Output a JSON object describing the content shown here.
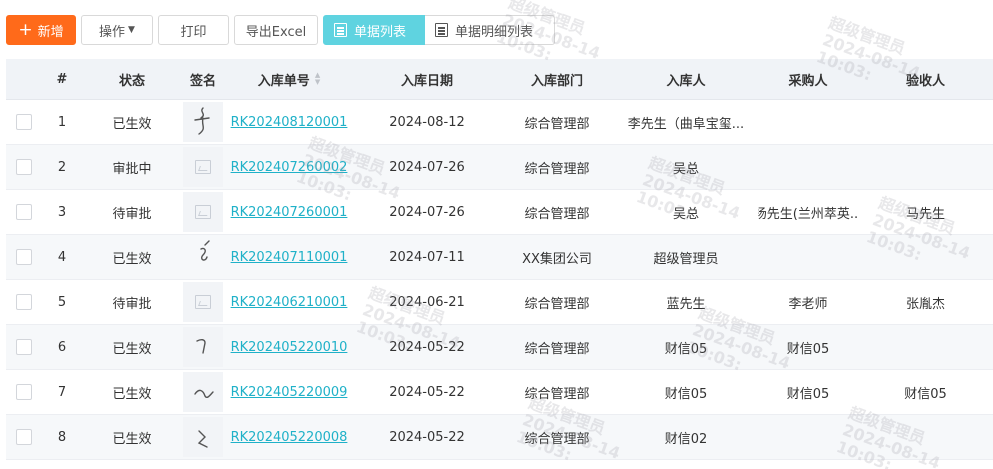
{
  "toolbar": {
    "add_label": "新增",
    "ops_label": "操作",
    "print_label": "打印",
    "export_label": "导出Excel"
  },
  "view_tabs": {
    "list_label": "单据列表",
    "detail_label": "单据明细列表",
    "active": "单据列表"
  },
  "table": {
    "headers": {
      "num": "#",
      "status": "状态",
      "signature": "签名",
      "doc_no": "入库单号",
      "date": "入库日期",
      "dept": "入库部门",
      "receiver": "入库人",
      "buyer": "采购人",
      "checker": "验收人"
    },
    "rows": [
      {
        "num": "1",
        "status": "已生效",
        "sig": "handwritten",
        "doc_no": "RK202408120001",
        "date": "2024-08-12",
        "dept": "综合管理部",
        "receiver": "李先生（曲阜宝玺...",
        "buyer": "",
        "checker": ""
      },
      {
        "num": "2",
        "status": "审批中",
        "sig": "placeholder",
        "doc_no": "RK202407260002",
        "date": "2024-07-26",
        "dept": "综合管理部",
        "receiver": "吴总",
        "buyer": "",
        "checker": ""
      },
      {
        "num": "3",
        "status": "待审批",
        "sig": "placeholder",
        "doc_no": "RK202407260001",
        "date": "2024-07-26",
        "dept": "综合管理部",
        "receiver": "吴总",
        "buyer": "杨先生(兰州萃英...",
        "checker": "马先生"
      },
      {
        "num": "4",
        "status": "已生效",
        "sig": "handwritten",
        "doc_no": "RK202407110001",
        "date": "2024-07-11",
        "dept": "XX集团公司",
        "receiver": "超级管理员",
        "buyer": "",
        "checker": ""
      },
      {
        "num": "5",
        "status": "待审批",
        "sig": "placeholder",
        "doc_no": "RK202406210001",
        "date": "2024-06-21",
        "dept": "综合管理部",
        "receiver": "蓝先生",
        "buyer": "李老师",
        "checker": "张胤杰"
      },
      {
        "num": "6",
        "status": "已生效",
        "sig": "handwritten",
        "doc_no": "RK202405220010",
        "date": "2024-05-22",
        "dept": "综合管理部",
        "receiver": "财信05",
        "buyer": "财信05",
        "checker": ""
      },
      {
        "num": "7",
        "status": "已生效",
        "sig": "handwritten",
        "doc_no": "RK202405220009",
        "date": "2024-05-22",
        "dept": "综合管理部",
        "receiver": "财信05",
        "buyer": "财信05",
        "checker": "财信05"
      },
      {
        "num": "8",
        "status": "已生效",
        "sig": "handwritten",
        "doc_no": "RK202405220008",
        "date": "2024-05-22",
        "dept": "综合管理部",
        "receiver": "财信02",
        "buyer": "",
        "checker": ""
      }
    ]
  },
  "watermark": {
    "name": "超级管理员",
    "date": "2024-08-14",
    "time": "10:03:"
  },
  "colors": {
    "primary": "#ff6a1a",
    "active_tab": "#5fd3e0",
    "link": "#1fb1c8"
  }
}
